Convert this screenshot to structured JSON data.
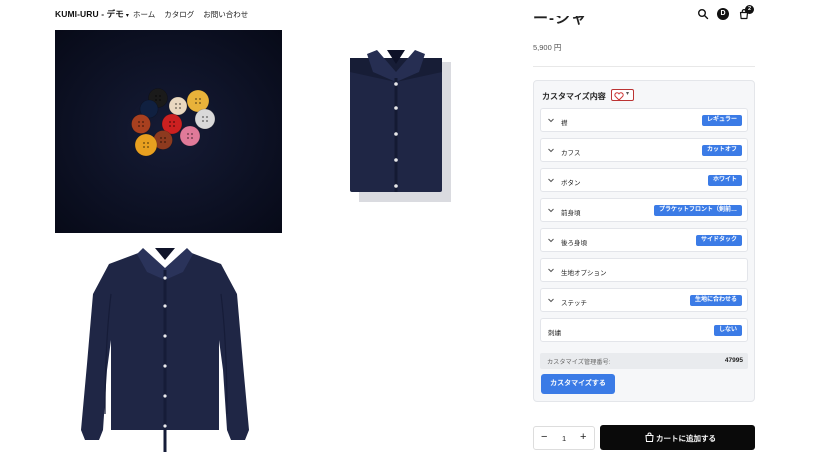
{
  "header": {
    "brand": "KUMI-URU - デモ",
    "nav": [
      "ホーム",
      "カタログ",
      "お問い合わせ"
    ],
    "account_initial": "D",
    "cart_count": "2",
    "icons": [
      "search-icon",
      "account-icon",
      "cart-icon"
    ]
  },
  "product": {
    "title_fragment": "ー-シャ",
    "price": "5,900 円"
  },
  "customize": {
    "title": "カスタマイズ内容",
    "options": [
      {
        "label": "襟",
        "value": "レギュラー",
        "chevron": true
      },
      {
        "label": "カフス",
        "value": "カットオフ",
        "chevron": true
      },
      {
        "label": "ボタン",
        "value": "ホワイト",
        "chevron": true
      },
      {
        "label": "前身頃",
        "value": "プラケットフロント（剣前…",
        "chevron": true
      },
      {
        "label": "後ろ身頃",
        "value": "サイドタック",
        "chevron": true
      },
      {
        "label": "生地オプション",
        "value": "",
        "chevron": true
      },
      {
        "label": "ステッチ",
        "value": "生地に合わせる",
        "chevron": true
      },
      {
        "label": "刺繍",
        "value": "しない",
        "chevron": false
      }
    ],
    "mgmt_label": "カスタマイズ管理番号:",
    "mgmt_value": "47995",
    "button": "カスタマイズする"
  },
  "purchase": {
    "quantity": "1",
    "minus": "−",
    "plus": "+",
    "add_to_cart": "カートに追加する"
  },
  "colors": {
    "accent": "#3b7be6",
    "navy": "#1d2440",
    "dark": "#0a0a0a"
  }
}
